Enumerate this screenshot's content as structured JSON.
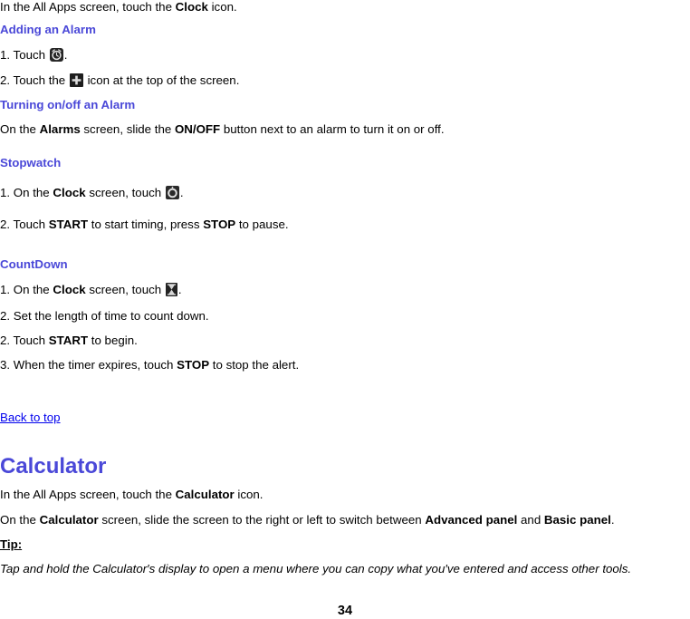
{
  "document": {
    "page_number": "34"
  },
  "intro": {
    "before": "In the All Apps screen, touch the ",
    "bold": "Clock",
    "after": " icon."
  },
  "sections": {
    "adding_alarm": {
      "heading": "Adding an Alarm",
      "step1_before": "1. Touch ",
      "step1_icon": "alarm-clock-icon",
      "step1_after": ".",
      "step2_before": "2. Touch the ",
      "step2_icon": "plus-icon",
      "step2_after": "  icon at the top of the screen."
    },
    "turning_alarm": {
      "heading": "Turning on/off an Alarm",
      "line_a": "On the ",
      "line_bold1": "Alarms",
      "line_b": " screen, slide the ",
      "line_bold2": "ON/OFF",
      "line_c": " button next to an alarm to turn it on or off."
    },
    "stopwatch": {
      "heading": "Stopwatch",
      "step1_a": "1. On the ",
      "step1_bold": "Clock",
      "step1_b": " screen, touch ",
      "step1_icon": "stopwatch-icon",
      "step1_c": ".",
      "step2_a": "2. Touch ",
      "step2_bold1": "START",
      "step2_b": " to start timing, press ",
      "step2_bold2": "STOP",
      "step2_c": " to pause."
    },
    "countdown": {
      "heading": "CountDown",
      "step1_a": "1. On the ",
      "step1_bold": "Clock",
      "step1_b": " screen, touch ",
      "step1_icon": "hourglass-timer-icon",
      "step1_c": ".",
      "step2": "2. Set the length of time to count down.",
      "step3_a": "2. Touch ",
      "step3_bold": "START",
      "step3_b": " to begin.",
      "step4_a": "3. When the timer expires, touch ",
      "step4_bold": "STOP",
      "step4_b": " to stop the alert."
    },
    "back_to_top": {
      "label": "Back to top"
    },
    "calculator": {
      "heading": "Calculator",
      "line1_a": "In the All Apps screen, touch the ",
      "line1_bold": "Calculator",
      "line1_b": " icon.",
      "line2_a": "On the ",
      "line2_bold1": "Calculator",
      "line2_b": " screen, slide the screen to the right or left to switch between ",
      "line2_bold2": "Advanced panel",
      "line2_c": " and ",
      "line2_bold3": "Basic panel",
      "line2_d": ".",
      "tip_label": "Tip:",
      "tip_text": "Tap and hold the Calculator′s display to open a menu where you can copy what you′ve entered and access other tools."
    }
  },
  "colors": {
    "heading": "#4a48d8",
    "link": "#0000ee",
    "text": "#000000",
    "background": "#ffffff"
  }
}
